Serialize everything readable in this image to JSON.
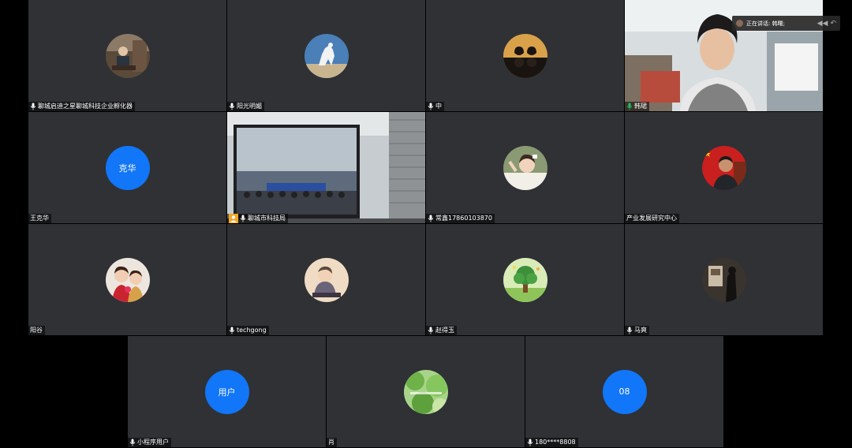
{
  "speaking_indicator": {
    "label": "正在讲话: 韩曙;"
  },
  "participants": [
    {
      "name": "聊城启迪之星聊城科技企业孵化器",
      "avatar": "person-desk-photo"
    },
    {
      "name": "阳光明媚",
      "avatar": "white-horse-photo"
    },
    {
      "name": "中",
      "avatar": "heart-hands-photo"
    },
    {
      "name": "韩珺",
      "avatar": "live-video"
    },
    {
      "name": "王克华",
      "avatar_text": "克华"
    },
    {
      "name": "聊城市科技局",
      "avatar": "meeting-room-video"
    },
    {
      "name": "常鑫17860103870",
      "avatar": "child-photo"
    },
    {
      "name": "产业发展研究中心",
      "avatar": "flag-portrait-photo"
    },
    {
      "name": "阳谷",
      "avatar": "two-children-photo"
    },
    {
      "name": "techgong",
      "avatar": "baby-photo"
    },
    {
      "name": "赵得玉",
      "avatar": "tree-illustration"
    },
    {
      "name": "马爽",
      "avatar": "dark-silhouette-photo"
    },
    {
      "name": "小程序用户",
      "avatar_text": "用户"
    },
    {
      "name": "肖",
      "avatar": "green-leaf-photo"
    },
    {
      "name": "180****8808",
      "avatar_text": "08"
    }
  ],
  "colors": {
    "tile_bg": "#2f3135",
    "avatar_blue": "#1176f7",
    "speaking_outline": "#22c55e",
    "host_badge": "#f5a623"
  }
}
